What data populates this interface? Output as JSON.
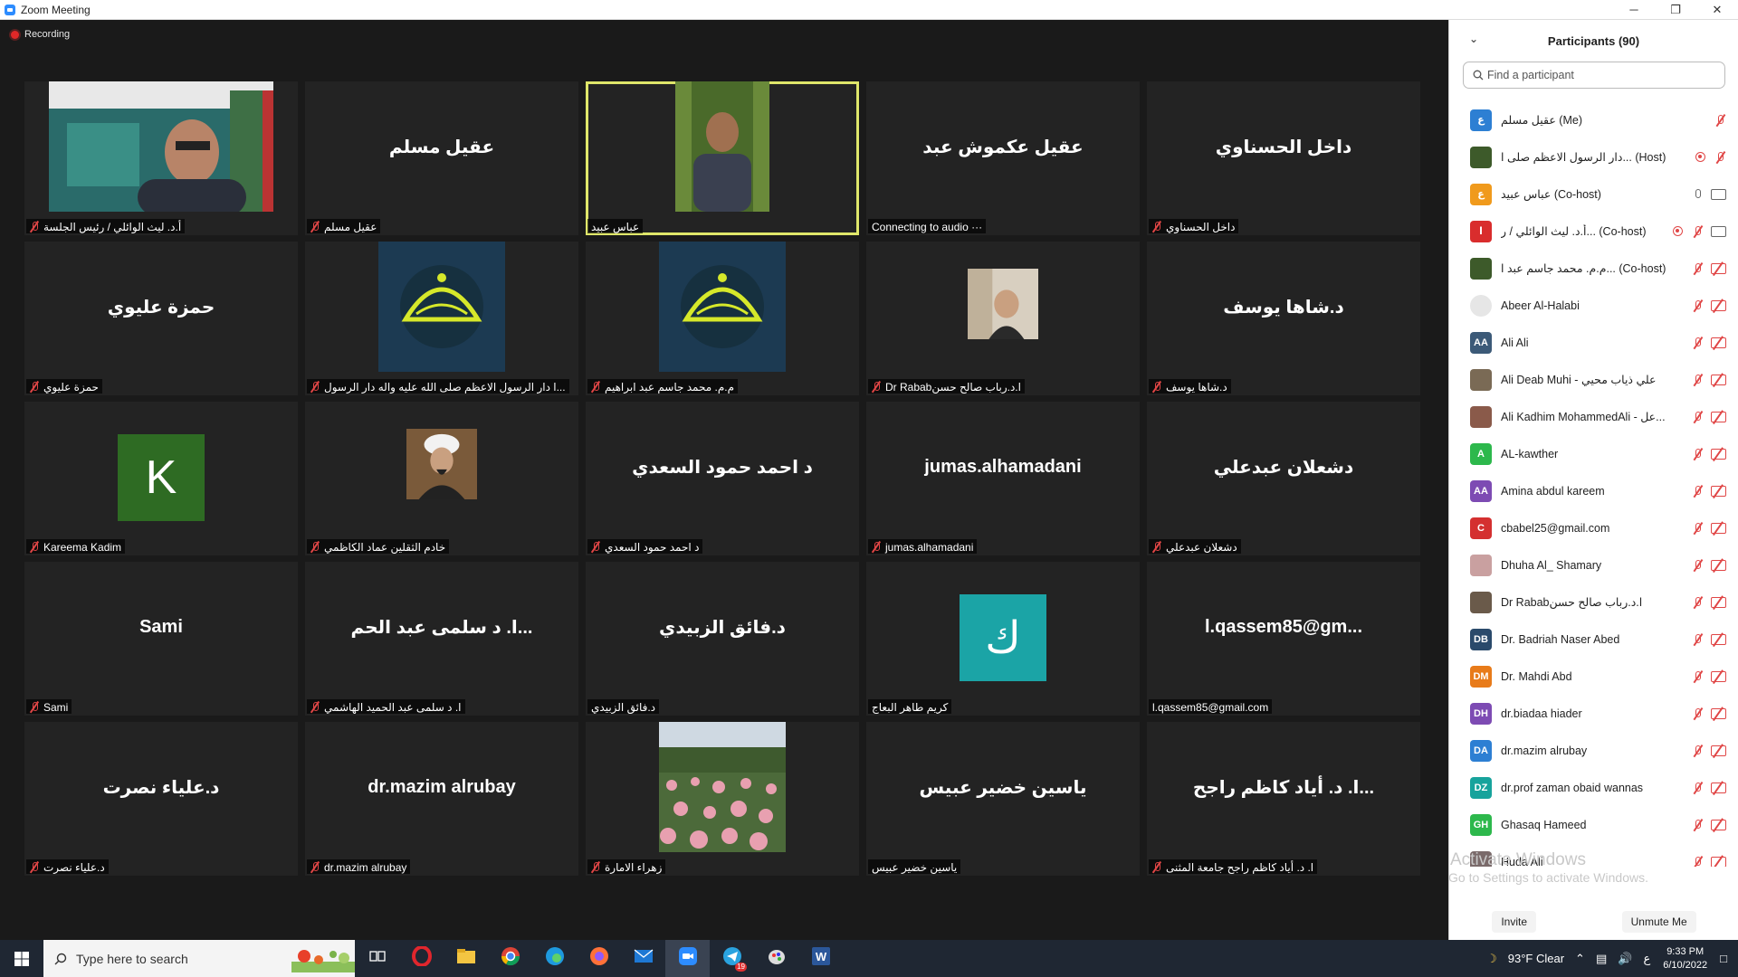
{
  "window": {
    "title": "Zoom Meeting",
    "minimize": "─",
    "restore": "❐",
    "close": "✕"
  },
  "meeting": {
    "recording_label": "Recording",
    "tiles": [
      {
        "label": "أ.د. ليث الوائلي / رئيس الجلسة",
        "big": "",
        "kind": "video-1",
        "muted": true
      },
      {
        "label": "عقيل مسلم",
        "big": "عقيل مسلم",
        "kind": "name",
        "muted": true
      },
      {
        "label": "عباس عبيد",
        "big": "",
        "kind": "video-2",
        "muted": false,
        "active": true
      },
      {
        "label": "Connecting to audio ···",
        "big": "عقيل عكموش عبد",
        "kind": "name",
        "muted": false
      },
      {
        "label": "داخل الحسناوي",
        "big": "داخل الحسناوي",
        "kind": "name",
        "muted": true
      },
      {
        "label": "حمزة عليوي",
        "big": "حمزة عليوي",
        "kind": "name",
        "muted": true
      },
      {
        "label": "ا دار الرسول الاعظم صلى الله عليه واله دار الرسول...",
        "big": "",
        "kind": "logo",
        "muted": true
      },
      {
        "label": "م.م. محمد جاسم عبد ابراهيم",
        "big": "",
        "kind": "logo",
        "muted": true
      },
      {
        "label": "Dr Rababا.د.رباب صالح حسن",
        "big": "",
        "kind": "photo-woman",
        "muted": true
      },
      {
        "label": "د.شاها يوسف",
        "big": "د.شاها يوسف",
        "kind": "name",
        "muted": true
      },
      {
        "label": "Kareema Kadim",
        "big": "",
        "kind": "avatar-k",
        "avatar_letter": "K",
        "muted": true
      },
      {
        "label": "خادم الثقلين عماد الكاظمي",
        "big": "",
        "kind": "photo-cleric",
        "muted": true
      },
      {
        "label": "د احمد حمود السعدي",
        "big": "د احمد حمود السعدي",
        "kind": "name",
        "muted": true
      },
      {
        "label": "jumas.alhamadani",
        "big": "jumas.alhamadani",
        "kind": "name",
        "muted": true
      },
      {
        "label": "دشعلان عبدعلي",
        "big": "دشعلان عبدعلي",
        "kind": "name",
        "muted": true
      },
      {
        "label": "Sami",
        "big": "Sami",
        "kind": "name",
        "muted": true
      },
      {
        "label": "ا. د سلمى عبد الحميد الهاشمي",
        "big": "ا. د سلمى عبد الحم...",
        "kind": "name",
        "muted": true
      },
      {
        "label": "د.فائق الزبيدي",
        "big": "د.فائق الزبيدي",
        "kind": "name",
        "muted": false
      },
      {
        "label": "كريم طاهر البعاج",
        "big": "",
        "kind": "avatar-k2",
        "avatar_letter": "ك",
        "muted": false
      },
      {
        "label": "l.qassem85@gmail.com",
        "big": "l.qassem85@gm...",
        "kind": "name",
        "muted": false
      },
      {
        "label": "د.علياء نصرت",
        "big": "د.علياء نصرت",
        "kind": "name",
        "muted": true
      },
      {
        "label": "dr.mazim alrubay",
        "big": "dr.mazim alrubay",
        "kind": "name",
        "muted": true
      },
      {
        "label": "زهراء الامارة",
        "big": "",
        "kind": "photo-flowers",
        "muted": true
      },
      {
        "label": "ياسين خضير عبيس",
        "big": "ياسين خضير عبيس",
        "kind": "name",
        "muted": false
      },
      {
        "label": "ا. د. أياد كاظم راجح جامعة المثنى",
        "big": "ا. د. أياد كاظم راجح...",
        "kind": "name",
        "muted": true
      }
    ]
  },
  "panel": {
    "title": "Participants (90)",
    "search_placeholder": "Find a participant",
    "participants": [
      {
        "name": "عقيل مسلم (Me)",
        "avatar": "ع",
        "color": "#2d7fd3",
        "mic": "muted",
        "cam": "none"
      },
      {
        "name": "دار الرسول الاعظم صلى ا... (Host)",
        "avatar": "",
        "color": "#3d5a2a",
        "mic": "muted",
        "cam": "none",
        "rec": true
      },
      {
        "name": "عباس عبيد (Co-host)",
        "avatar": "ع",
        "color": "#f09a1c",
        "mic": "on",
        "cam": "on"
      },
      {
        "name": "أ.د. ليث الوائلي / ر... (Co-host)",
        "avatar": "ا",
        "color": "#d92d2d",
        "mic": "muted",
        "cam": "on",
        "rec": true
      },
      {
        "name": "م.م. محمد جاسم عبد ا... (Co-host)",
        "avatar": "",
        "color": "#3d5a2a",
        "mic": "muted",
        "cam": "off"
      },
      {
        "name": "Abeer Al-Halabi",
        "avatar": "",
        "color": "#e6e6e6",
        "mic": "muted",
        "cam": "off"
      },
      {
        "name": "Ali Ali",
        "avatar": "AA",
        "color": "#3c5a78",
        "mic": "muted",
        "cam": "off"
      },
      {
        "name": "Ali Deab Muhi - علي ذياب محيي",
        "avatar": "",
        "color": "#7a6a55",
        "mic": "muted",
        "cam": "off"
      },
      {
        "name": "Ali Kadhim MohammedAli - عل...",
        "avatar": "",
        "color": "#8a5a4a",
        "mic": "muted",
        "cam": "off"
      },
      {
        "name": "AL-kawther",
        "avatar": "A",
        "color": "#2db84c",
        "mic": "muted",
        "cam": "off"
      },
      {
        "name": "Amina abdul kareem",
        "avatar": "AA",
        "color": "#7d4bb3",
        "mic": "muted",
        "cam": "off"
      },
      {
        "name": "cbabel25@gmail.com",
        "avatar": "C",
        "color": "#d43030",
        "mic": "muted",
        "cam": "off"
      },
      {
        "name": "Dhuha Al_ Shamary",
        "avatar": "",
        "color": "#c9a0a0",
        "mic": "muted",
        "cam": "off"
      },
      {
        "name": "Dr Rababا.د.رباب صالح حسن",
        "avatar": "",
        "color": "#6a5a4a",
        "mic": "muted",
        "cam": "off"
      },
      {
        "name": "Dr. Badriah Naser Abed",
        "avatar": "DB",
        "color": "#2a4a6b",
        "mic": "muted",
        "cam": "off"
      },
      {
        "name": "Dr. Mahdi Abd",
        "avatar": "DM",
        "color": "#e87b1a",
        "mic": "muted",
        "cam": "off"
      },
      {
        "name": "dr.biadaa hiader",
        "avatar": "DH",
        "color": "#7d4bb3",
        "mic": "muted",
        "cam": "off"
      },
      {
        "name": "dr.mazim alrubay",
        "avatar": "DA",
        "color": "#2d7fd3",
        "mic": "muted",
        "cam": "off"
      },
      {
        "name": "dr.prof zaman obaid wannas",
        "avatar": "DZ",
        "color": "#17a39c",
        "mic": "muted",
        "cam": "off"
      },
      {
        "name": "Ghasaq Hameed",
        "avatar": "GH",
        "color": "#2db84c",
        "mic": "muted",
        "cam": "off"
      },
      {
        "name": "Huda Ali",
        "avatar": "",
        "color": "#7a6a6a",
        "mic": "muted",
        "cam": "off"
      }
    ],
    "invite_label": "Invite",
    "unmute_label": "Unmute Me"
  },
  "watermark": {
    "line1": "Activate Windows",
    "line2": "Go to Settings to activate Windows."
  },
  "taskbar": {
    "search_placeholder": "Type here to search",
    "weather": "93°F  Clear",
    "lang": "ع",
    "time": "9:33 PM",
    "date": "6/10/2022",
    "icons": [
      "task-view-icon",
      "opera-icon",
      "file-explorer-icon",
      "chrome-icon",
      "edge-icon",
      "firefox-icon",
      "mail-icon",
      "zoom-icon",
      "telegram-icon",
      "paint-icon",
      "word-icon"
    ],
    "telegram_badge": "19"
  }
}
